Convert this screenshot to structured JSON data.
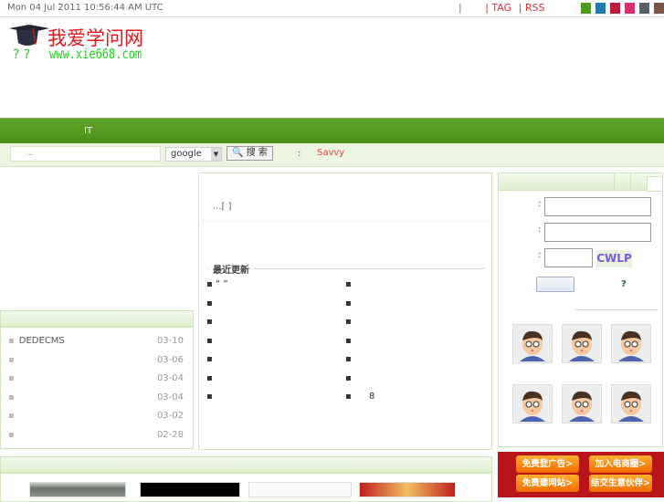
{
  "topbar": {
    "date": "Mon 04 Jul 2011 10:56:44 AM UTC",
    "sep": "|",
    "links": [
      "| TAG",
      "| RSS"
    ],
    "swatches": [
      "#4d9a1e",
      "#2478b0",
      "#c01a3a",
      "#d8306e",
      "#5a6068",
      "#7a5548"
    ]
  },
  "logo": {
    "cn": "我爱学问网",
    "url": "www.xie668.com",
    "q": "? ?"
  },
  "nav": {
    "item": "IT"
  },
  "search": {
    "placeholder": "...",
    "engine": "google",
    "button": "搜 索",
    "colon": ":",
    "hot": "Savvy"
  },
  "left_list": {
    "items": [
      {
        "title": "DEDECMS",
        "date": "03-10"
      },
      {
        "title": "",
        "date": "03-06"
      },
      {
        "title": "",
        "date": "03-04"
      },
      {
        "title": "",
        "date": "03-04"
      },
      {
        "title": "",
        "date": "03-02"
      },
      {
        "title": "",
        "date": "02-28"
      }
    ]
  },
  "middle": {
    "intro": "...[ ]",
    "recent_title": "最近更新",
    "col1": [
      "“ ”",
      "",
      "",
      "",
      "",
      "",
      ""
    ],
    "col2": [
      "",
      "",
      "",
      "",
      "",
      "",
      "8"
    ]
  },
  "login": {
    "colon": ":",
    "captcha": "CWLP",
    "help": "?"
  },
  "ads": [
    "免费登广告>",
    "加入电商圈>",
    "免费建网站>",
    "结交生意伙伴>"
  ]
}
